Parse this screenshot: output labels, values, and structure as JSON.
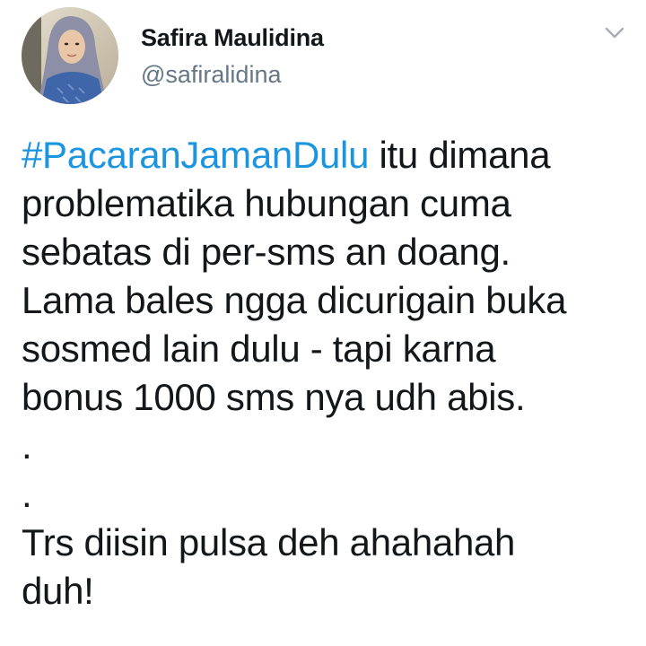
{
  "tweet": {
    "author": {
      "display_name": "Safira Maulidina",
      "handle": "@safiralidina",
      "avatar_icon": "profile-photo"
    },
    "menu_icon": "chevron-down-icon",
    "hashtag": "#PacaranJamanDulu",
    "body": {
      "line1_rest": " itu dimana",
      "line2": "problematika hubungan cuma",
      "line3": "sebatas di per-sms an doang.",
      "line4": "Lama bales ngga dicurigain buka",
      "line5": "sosmed lain dulu - tapi karna",
      "line6": "bonus 1000 sms nya udh abis.",
      "dot1": ".",
      "dot2": ".",
      "line7": "Trs diisin pulsa deh ahahahah",
      "line8": "duh!"
    },
    "colors": {
      "hashtag": "#1b95e0",
      "handle": "#657786",
      "text": "#14171a"
    }
  }
}
